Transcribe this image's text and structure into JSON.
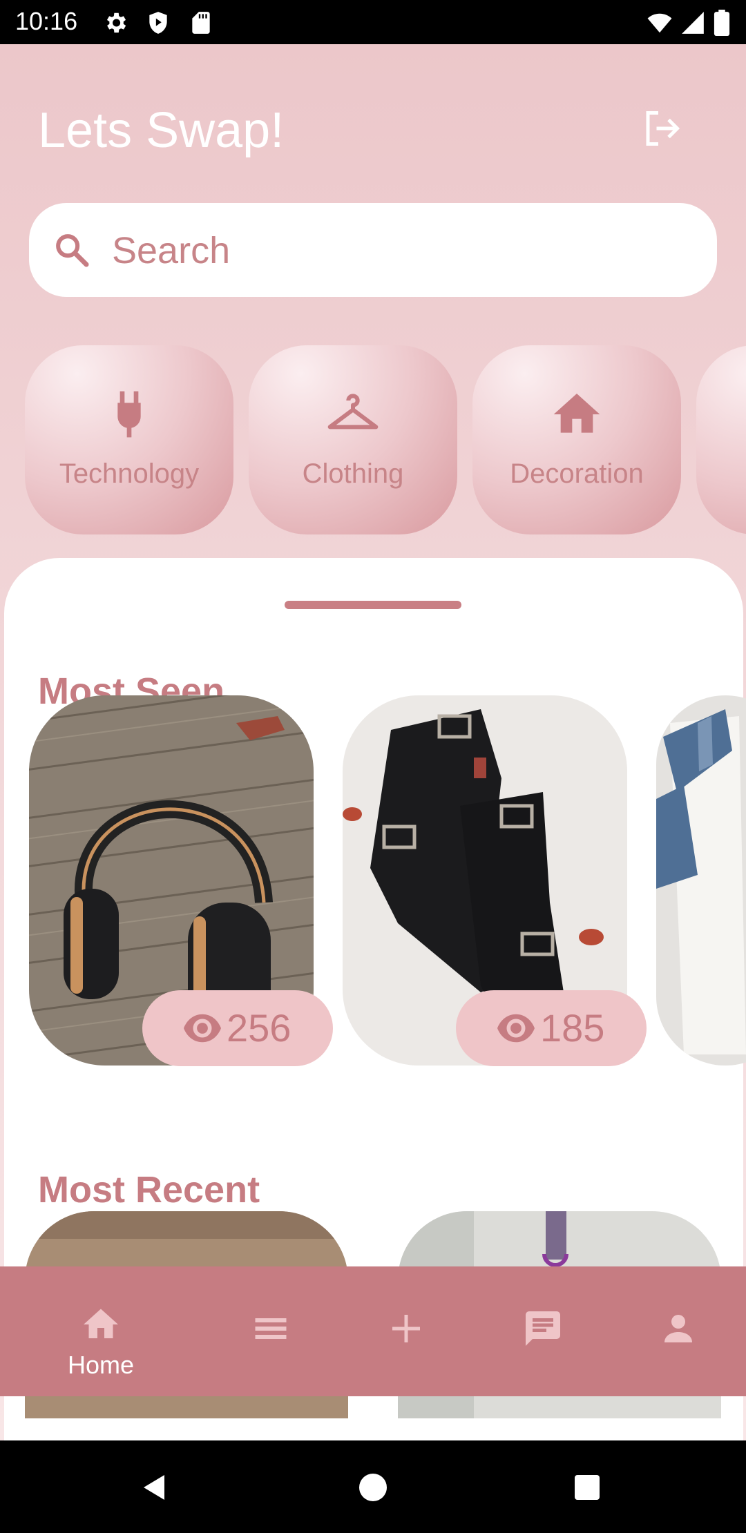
{
  "status_bar": {
    "time": "10:16",
    "left_icons": [
      "settings-icon",
      "shield-play-icon",
      "sd-card-icon"
    ],
    "right_icons": [
      "wifi-icon",
      "signal-icon",
      "battery-icon"
    ]
  },
  "header": {
    "title": "Lets Swap!",
    "logout_icon": "logout-icon"
  },
  "search": {
    "placeholder": "Search",
    "value": ""
  },
  "categories": [
    {
      "label": "Technology",
      "icon": "plug-icon"
    },
    {
      "label": "Clothing",
      "icon": "hanger-icon"
    },
    {
      "label": "Decoration",
      "icon": "home-icon"
    }
  ],
  "sections": {
    "most_seen": "Most Seen",
    "most_recent": "Most Recent"
  },
  "most_seen_items": [
    {
      "image": "headphones-photo",
      "views": "256"
    },
    {
      "image": "black-boots-photo",
      "views": "185"
    },
    {
      "image": "tshirt-photo"
    }
  ],
  "most_recent_items": [
    {
      "image": "recent-photo-1"
    },
    {
      "image": "recent-photo-2"
    }
  ],
  "bottom_nav": {
    "items": [
      {
        "label": "Home",
        "icon": "home-icon",
        "active": true
      },
      {
        "label": "",
        "icon": "menu-icon"
      },
      {
        "label": "",
        "icon": "plus-icon"
      },
      {
        "label": "",
        "icon": "chat-icon"
      },
      {
        "label": "",
        "icon": "person-icon"
      }
    ]
  },
  "colors": {
    "accent": "#c67c82",
    "chip_pale": "#efc5c8",
    "background_top": "#ecc7ca",
    "white": "#ffffff"
  }
}
